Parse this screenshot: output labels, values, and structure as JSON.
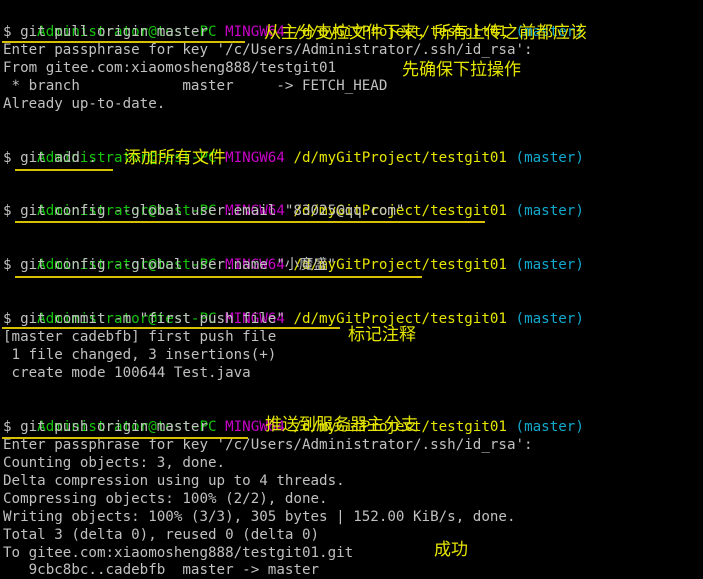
{
  "prompt": {
    "user": "Administrator@test-PC",
    "env": "MINGW64",
    "path": "/d/myGitProject/testgit01",
    "branch": "(master)"
  },
  "lines": [
    "$ git pull origin master",
    "Enter passphrase for key '/c/Users/Administrator/.ssh/id_rsa':",
    "From gitee.com:xiaomosheng888/testgit01",
    " * branch            master     -> FETCH_HEAD",
    "Already up-to-date.",
    "$ git add .",
    "$ git config --global user.email \"83025@qq.com\"",
    "$ git config --global user.name \"小魔盛\"",
    "$ git commit -m \"first push file\"",
    "[master cadebfb] first push file",
    " 1 file changed, 3 insertions(+)",
    " create mode 100644 Test.java",
    "$ git push origin master",
    "Enter passphrase for key '/c/Users/Administrator/.ssh/id_rsa':",
    "Counting objects: 3, done.",
    "Delta compression using up to 4 threads.",
    "Compressing objects: 100% (2/2), done.",
    "Writing objects: 100% (3/3), 305 bytes | 152.00 KiB/s, done.",
    "Total 3 (delta 0), reused 0 (delta 0)",
    "To gitee.com:xiaomosheng888/testgit01.git",
    "   9cbc8bc..cadebfb  master -> master"
  ],
  "annotations": {
    "pull": "从主分支拉文件下来，所有上传之前都应该",
    "pull_cont": "先确保下拉操作",
    "add": "添加所有文件",
    "commit": "标记注释",
    "push": "推送到服务器主分支",
    "success": "成功"
  },
  "colors": {
    "background": "#000000",
    "prompt_user": "#16c60c",
    "prompt_env": "#c800c8",
    "prompt_path": "#e5e500",
    "prompt_branch": "#11a8cd",
    "output_text": "#c0c0c0",
    "annotation": "#e5e500"
  }
}
